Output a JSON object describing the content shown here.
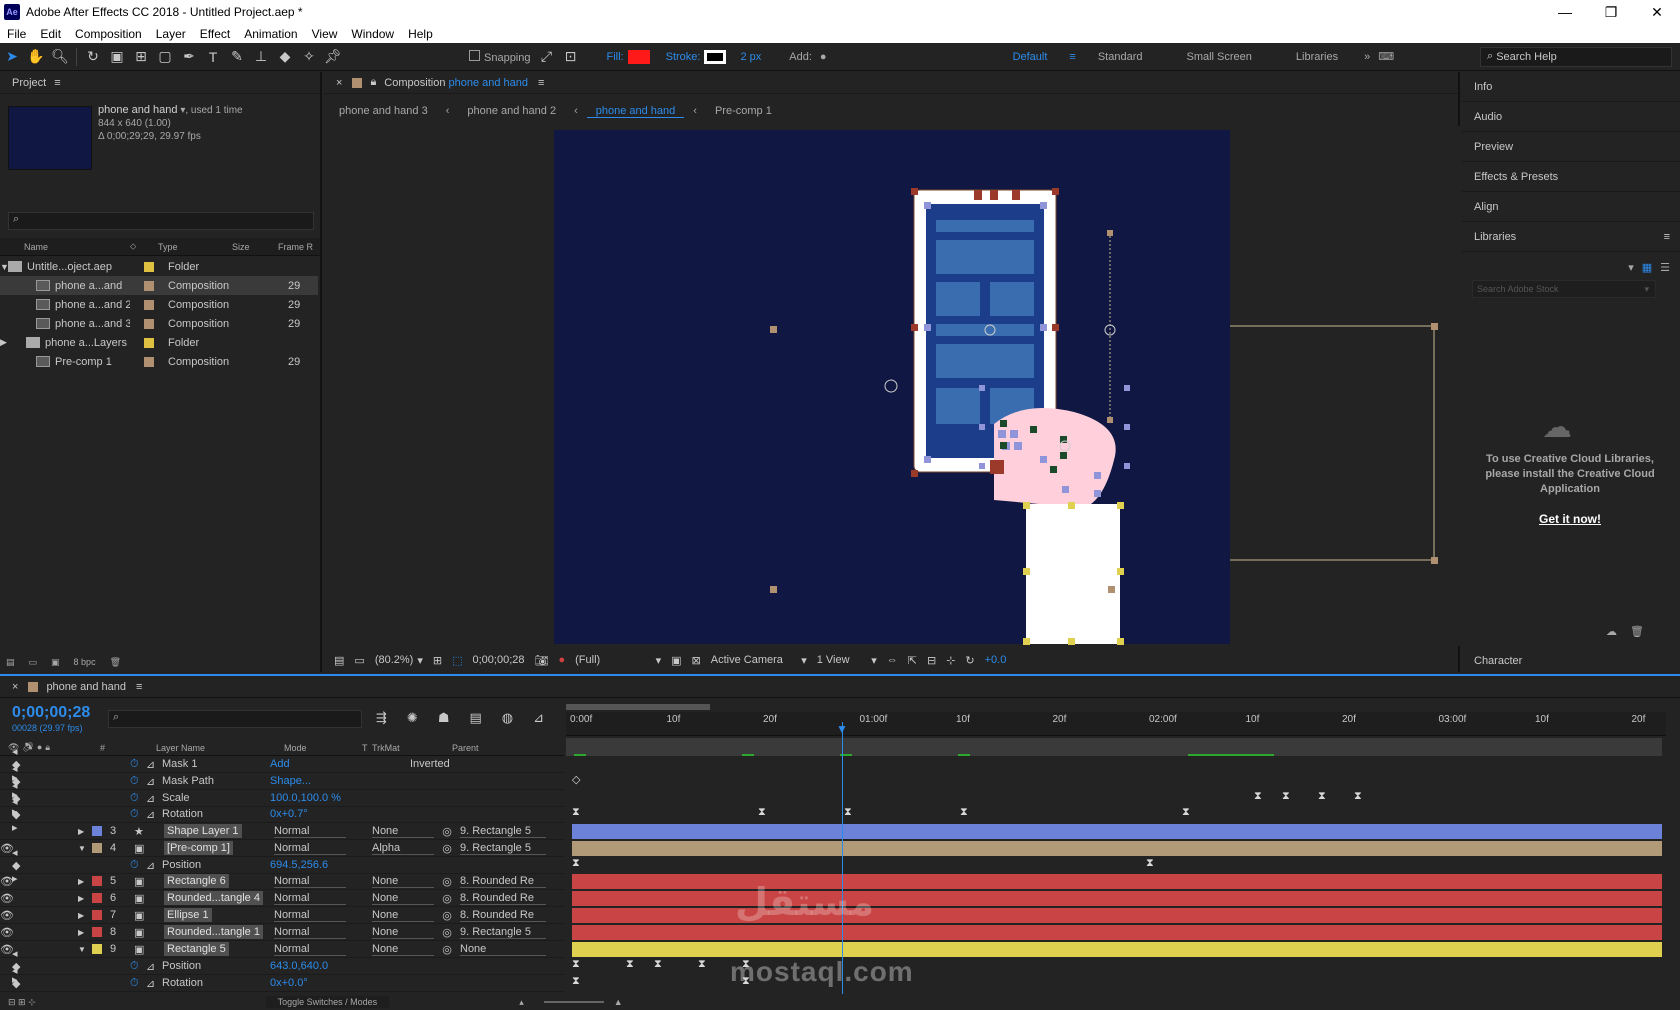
{
  "window": {
    "title": "Adobe After Effects CC 2018 - Untitled Project.aep *",
    "app_icon": "Ae"
  },
  "menu": [
    "File",
    "Edit",
    "Composition",
    "Layer",
    "Effect",
    "Animation",
    "View",
    "Window",
    "Help"
  ],
  "toolbar": {
    "snapping": "Snapping",
    "fill_label": "Fill:",
    "stroke_label": "Stroke:",
    "stroke_width": "2 px",
    "add_label": "Add:",
    "fill_color": "#ff1a1a",
    "workspaces": [
      "Default",
      "Standard",
      "Small Screen",
      "Libraries"
    ],
    "search_help": "Search Help"
  },
  "project": {
    "panel_title": "Project",
    "selected_name": "phone and hand",
    "used": ", used 1 time",
    "dims": "844 x 640 (1.00)",
    "duration": "Δ 0;00;29;29, 29.97 fps",
    "columns": [
      "Name",
      "Type",
      "Size",
      "Frame R"
    ],
    "items": [
      {
        "name": "Untitle...oject.aep",
        "type": "Folder",
        "frames": "",
        "icon": "folder",
        "color": "#e0c040"
      },
      {
        "name": "phone a...and",
        "type": "Composition",
        "frames": "29",
        "icon": "comp",
        "color": "#b09070"
      },
      {
        "name": "phone a...and 2",
        "type": "Composition",
        "frames": "29",
        "icon": "comp",
        "color": "#b09070"
      },
      {
        "name": "phone a...and 3",
        "type": "Composition",
        "frames": "29",
        "icon": "comp",
        "color": "#b09070"
      },
      {
        "name": "phone a...Layers",
        "type": "Folder",
        "frames": "",
        "icon": "folder",
        "color": "#e0c040"
      },
      {
        "name": "Pre-comp 1",
        "type": "Composition",
        "frames": "29",
        "icon": "comp",
        "color": "#b09070"
      }
    ],
    "bpc": "8 bpc"
  },
  "composition": {
    "panel_label": "Composition",
    "panel_name": "phone and hand",
    "breadcrumbs": [
      "phone and hand 3",
      "phone and hand 2",
      "phone and hand",
      "Pre-comp 1"
    ],
    "active_crumb": 2,
    "zoom": "(80.2%)",
    "timecode": "0;00;00;28",
    "resolution": "(Full)",
    "camera": "Active Camera",
    "views": "1 View",
    "exposure": "+0.0"
  },
  "right_panel": {
    "items": [
      "Info",
      "Audio",
      "Preview",
      "Effects & Presets",
      "Align",
      "Libraries"
    ],
    "lib_search": "Search Adobe Stock",
    "lib_message": "To use Creative Cloud Libraries, please install the Creative Cloud Application",
    "lib_cta": "Get it now!",
    "character": "Character"
  },
  "timeline": {
    "comp_name": "phone and hand",
    "timecode": "0;00;00;28",
    "timecode_sub": "00028 (29.97 fps)",
    "columns": [
      "#",
      "Layer Name",
      "Mode",
      "T",
      "TrkMat",
      "Parent"
    ],
    "ruler": [
      "0:00f",
      "10f",
      "20f",
      "01:00f",
      "10f",
      "20f",
      "02:00f",
      "10f",
      "20f",
      "03:00f",
      "10f",
      "20f"
    ],
    "rows": [
      {
        "kind": "prop",
        "label": "Mask 1",
        "value": "Add",
        "extra": "Inverted"
      },
      {
        "kind": "prop",
        "label": "Mask Path",
        "value": "Shape..."
      },
      {
        "kind": "prop",
        "label": "Scale",
        "value": "100.0,100.0 %"
      },
      {
        "kind": "prop",
        "label": "Rotation",
        "value": "0x+0.7°"
      },
      {
        "kind": "layer",
        "num": "3",
        "name": "Shape Layer 1",
        "mode": "Normal",
        "trk": "None",
        "parent": "9. Rectangle 5",
        "color": "#6b82d8"
      },
      {
        "kind": "layer",
        "num": "4",
        "name": "[Pre-comp 1]",
        "mode": "Normal",
        "trk": "Alpha",
        "parent": "9. Rectangle 5",
        "color": "#b09a78"
      },
      {
        "kind": "prop",
        "label": "Position",
        "value": "694.5,256.6"
      },
      {
        "kind": "layer",
        "num": "5",
        "name": "Rectangle 6",
        "mode": "Normal",
        "trk": "None",
        "parent": "8. Rounded Re",
        "color": "#c94444"
      },
      {
        "kind": "layer",
        "num": "6",
        "name": "Rounded...tangle 4",
        "mode": "Normal",
        "trk": "None",
        "parent": "8. Rounded Re",
        "color": "#c94444"
      },
      {
        "kind": "layer",
        "num": "7",
        "name": "Ellipse 1",
        "mode": "Normal",
        "trk": "None",
        "parent": "8. Rounded Re",
        "color": "#c94444"
      },
      {
        "kind": "layer",
        "num": "8",
        "name": "Rounded...tangle 1",
        "mode": "Normal",
        "trk": "None",
        "parent": "9. Rectangle 5",
        "color": "#c94444"
      },
      {
        "kind": "layer",
        "num": "9",
        "name": "Rectangle 5",
        "mode": "Normal",
        "trk": "None",
        "parent": "None",
        "color": "#e0d050"
      },
      {
        "kind": "prop",
        "label": "Position",
        "value": "643.0,640.0"
      },
      {
        "kind": "prop",
        "label": "Rotation",
        "value": "0x+0.0°"
      }
    ],
    "toggle": "Toggle Switches / Modes"
  },
  "watermark": {
    "arabic": "مستقل",
    "latin": "mostaql.com"
  }
}
